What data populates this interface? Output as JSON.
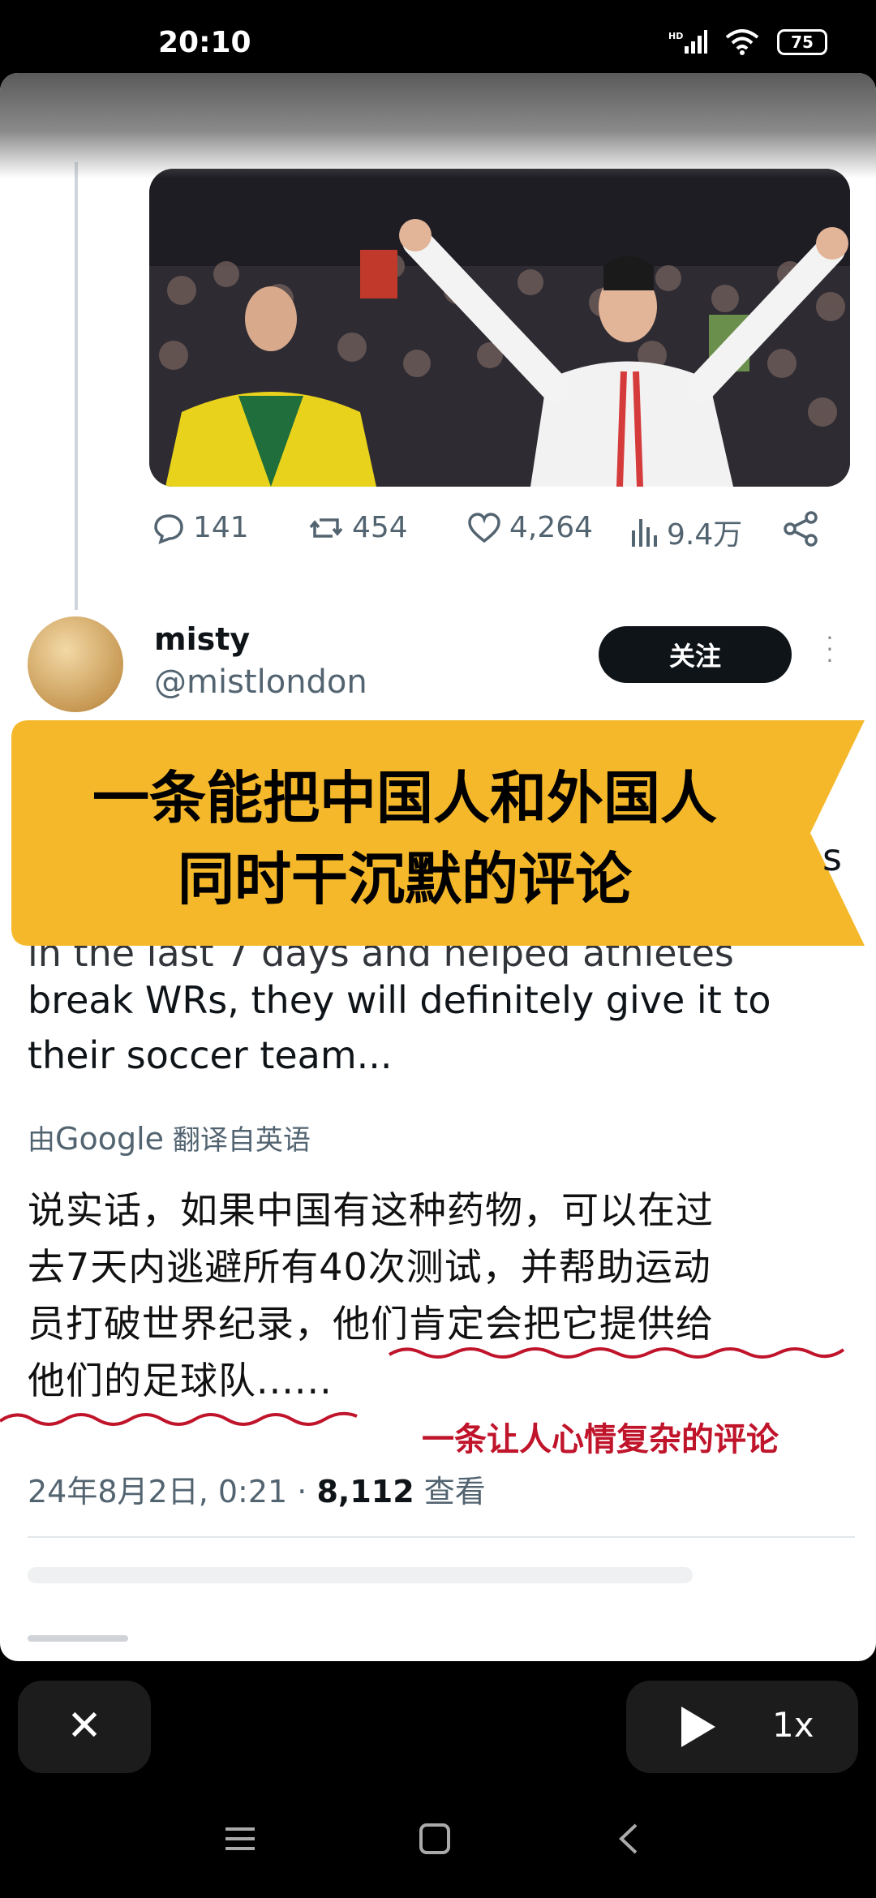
{
  "status": {
    "time": "20:10",
    "network": "HD",
    "battery": "75"
  },
  "tweet_stats": {
    "replies": "141",
    "retweets": "454",
    "likes": "4,264",
    "views": "9.4万"
  },
  "user": {
    "name": "misty",
    "handle": "@mistlondon",
    "follow_label": "关注"
  },
  "banner": {
    "line1": "一条能把中国人和外国人",
    "line2": "同时干沉默的评论",
    "clipped_tail": "s"
  },
  "original_text": {
    "partial_line": "in the last 7 days and helped athletes",
    "line2": "break WRs, they will definitely give it to",
    "line3": "their soccer team..."
  },
  "translation_note": {
    "prefix": "由",
    "google": "Google",
    "suffix": "翻译自英语"
  },
  "translated_text": {
    "line1": "说实话，如果中国有这种药物，可以在过",
    "line2": "去7天内逃避所有40次测试，并帮助运动",
    "line3": "员打破世界纪录，他们肯定会把它提供给",
    "line4": "他们的足球队......"
  },
  "caption": "一条让人心情复杂的评论",
  "meta": {
    "date": "24年8月2日, 0:21 · ",
    "views": "8,112",
    "views_label": " 查看"
  },
  "player": {
    "close": "✕",
    "speed": "1x"
  },
  "colors": {
    "banner": "#f5b82a",
    "accent_red": "#c0142b",
    "follow_bg": "#0f1419"
  }
}
